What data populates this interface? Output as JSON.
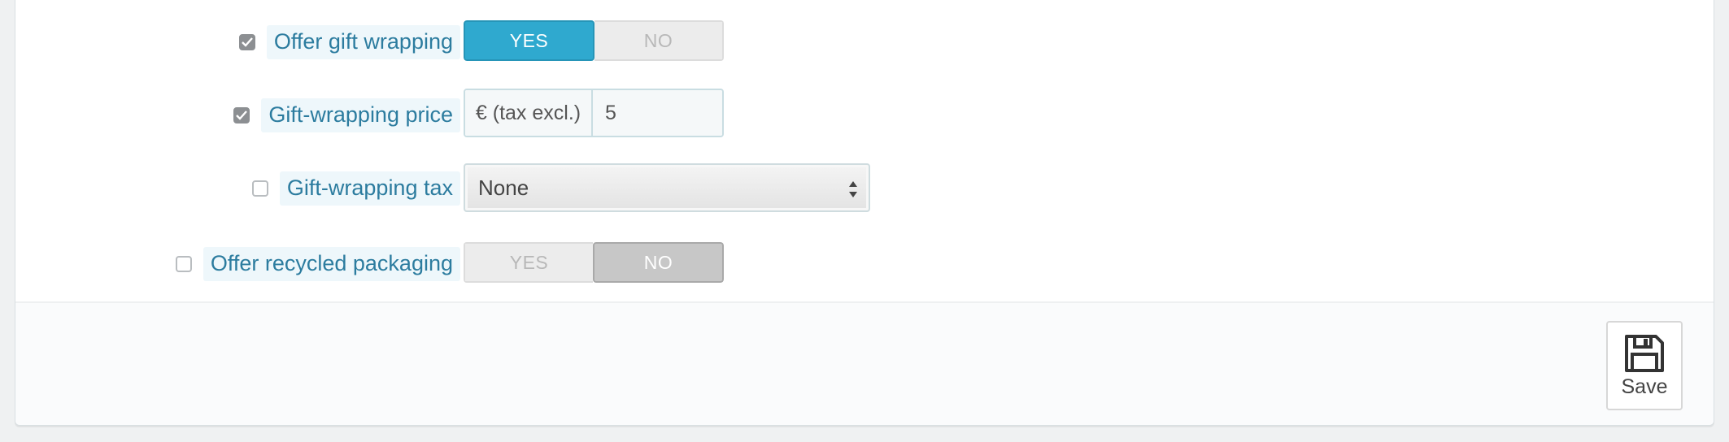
{
  "form": {
    "rows": [
      {
        "label": "Offer gift wrapping",
        "checked": true,
        "type": "switch",
        "yes_label": "YES",
        "no_label": "NO",
        "value": "YES"
      },
      {
        "label": "Gift-wrapping price",
        "checked": true,
        "type": "price",
        "addon": "€ (tax excl.)",
        "value": "5"
      },
      {
        "label": "Gift-wrapping tax",
        "checked": false,
        "type": "select",
        "value": "None"
      },
      {
        "label": "Offer recycled packaging",
        "checked": false,
        "type": "switch",
        "yes_label": "YES",
        "no_label": "NO",
        "value": "NO"
      }
    ]
  },
  "footer": {
    "save_label": "Save",
    "save_icon": "floppy-disk-icon"
  },
  "colors": {
    "accent": "#2fa9cf",
    "label_text": "#2c7c9f",
    "label_bg": "#eef7fb"
  }
}
